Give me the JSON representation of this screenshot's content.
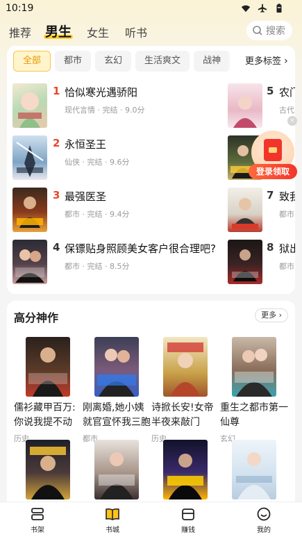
{
  "status_bar": {
    "time": "10:19"
  },
  "top_nav": {
    "tabs": [
      {
        "label": "推荐"
      },
      {
        "label": "男生"
      },
      {
        "label": "女生"
      },
      {
        "label": "听书"
      }
    ],
    "active_tab": "男生",
    "search_placeholder": "搜索"
  },
  "category": {
    "chips": [
      "全部",
      "都市",
      "玄幻",
      "生活爽文",
      "战神"
    ],
    "active_chip": "全部",
    "more_tags": "更多标签"
  },
  "ranking": {
    "left": [
      {
        "rank": "1",
        "title": "恰似寒光遇骄阳",
        "meta": "现代言情 · 完结 · 9.0分"
      },
      {
        "rank": "2",
        "title": "永恒圣王",
        "meta": "仙侠 · 完结 · 9.6分"
      },
      {
        "rank": "3",
        "title": "最强医圣",
        "meta": "都市 · 完结 · 9.4分"
      },
      {
        "rank": "4",
        "title": "保镖贴身照顾美女客户很合理吧?",
        "meta": "都市 · 完结 · 8.5分"
      }
    ],
    "right": [
      {
        "rank": "5",
        "title": "农门",
        "meta": "古代"
      },
      {
        "rank": "6",
        "title": "",
        "meta": ""
      },
      {
        "rank": "7",
        "title": "致我",
        "meta": "都市"
      },
      {
        "rank": "8",
        "title": "狱出",
        "meta": "都市"
      }
    ]
  },
  "float_widget": {
    "label": "登录领取",
    "close": "×"
  },
  "high_score": {
    "title": "高分神作",
    "more": "更多",
    "books": [
      {
        "title": "儒衫藏甲百万:你说我提不动枪?",
        "category": "历史"
      },
      {
        "title": "刚离婚,她小姨就官宣怀我三胞胎",
        "category": "都市"
      },
      {
        "title": "诗掀长安!女帝半夜来敲门",
        "category": "历史"
      },
      {
        "title": "重生之都市第一仙尊",
        "category": "玄幻"
      },
      {
        "title": "",
        "category": ""
      },
      {
        "title": "",
        "category": ""
      },
      {
        "title": "",
        "category": ""
      },
      {
        "title": "",
        "category": ""
      }
    ]
  },
  "bottom_bar": {
    "items": [
      {
        "label": "书架"
      },
      {
        "label": "书城"
      },
      {
        "label": "赚钱"
      },
      {
        "label": "我的"
      }
    ],
    "active": "书城"
  }
}
